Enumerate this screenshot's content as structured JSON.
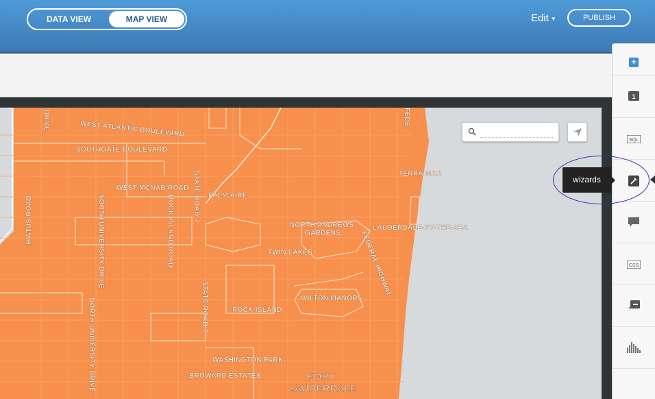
{
  "header": {
    "tabs": [
      {
        "label": "DATA VIEW",
        "active": false
      },
      {
        "label": "MAP VIEW",
        "active": true
      }
    ],
    "edit_label": "Edit",
    "publish_label": "PUBLISH",
    "accent_color": "#3f86c8"
  },
  "map": {
    "fill_color": "#f7904c",
    "water_color": "#d7dadd",
    "search": {
      "placeholder": ""
    },
    "labels": {
      "wab": "WEST ATLANTIC BOULEVARD",
      "southgate": "SOUTHGATE BOULEVARD",
      "mcnab": "WEST MCNAB ROAD",
      "palm_aire": "PALM AIRE",
      "state_road_7_a": "STATE ROAD 7",
      "state_road_7_b": "STATE ROAD 7",
      "rock_island_road": "ROCK ISLAND ROAD",
      "north_university_drive_a": "NORTH UNIVERSITY DRIVE",
      "north_university_drive_b": "NORTH UNIVERSITY DRIVE",
      "hiatus_road": "HIATUS ROAD",
      "drive_top": "DRIVE",
      "terra_mar": "TERRA MAR",
      "north_andrews_1": "NORTH ANDREWS",
      "north_andrews_2": "GARDENS",
      "lauderdale_by_the_sea": "LAUDERDALE-BY-THE-SEA",
      "federal_highway": "FEDERAL HIGHWAY",
      "twin_lakes": "TWIN LAKES",
      "wilton_manors": "WILTON MANORS",
      "rock_island": "ROCK ISLAND",
      "washington_park": "WASHINGTON PARK",
      "broward_estates": "BROWARD ESTATES",
      "fort": "FORT",
      "lauderdale": "LAUDERDALE",
      "fed_top": "FEDE"
    }
  },
  "right_panel": {
    "items": [
      {
        "name": "layer-1",
        "label": "1"
      },
      {
        "name": "sql",
        "label": "SQL"
      },
      {
        "name": "wizards",
        "label": "wizards"
      },
      {
        "name": "infowindow",
        "label": ""
      },
      {
        "name": "css",
        "label": "CSS"
      },
      {
        "name": "legends",
        "label": ""
      },
      {
        "name": "filters",
        "label": ""
      }
    ],
    "tooltip": "wizards",
    "add_label": "+"
  }
}
